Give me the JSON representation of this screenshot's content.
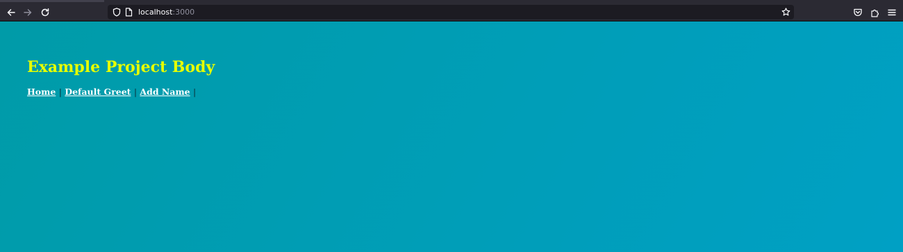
{
  "browser": {
    "url_host": "localhost",
    "url_port": ":3000",
    "icons": {
      "back": "arrow-left-icon",
      "forward": "arrow-right-icon",
      "reload": "reload-icon",
      "shield": "shield-icon",
      "page": "page-icon",
      "bookmark": "star-icon",
      "pocket": "pocket-icon",
      "extensions": "puzzle-icon",
      "menu": "hamburger-menu-icon"
    },
    "colors": {
      "toolbar": "#2b2a33",
      "urlbar": "#1c1b22",
      "icon": "#fbfbfe",
      "icon_disabled": "#8f8f9d"
    }
  },
  "page": {
    "title": "Example Project Body",
    "nav": {
      "links": [
        {
          "label": "Home"
        },
        {
          "label": "Default Greet"
        },
        {
          "label": "Add Name"
        }
      ],
      "separator": "|"
    },
    "colors": {
      "title": "#e6ff00",
      "link": "#ffffff",
      "background_start": "#009ba8",
      "background_end": "#00a0c4"
    }
  }
}
